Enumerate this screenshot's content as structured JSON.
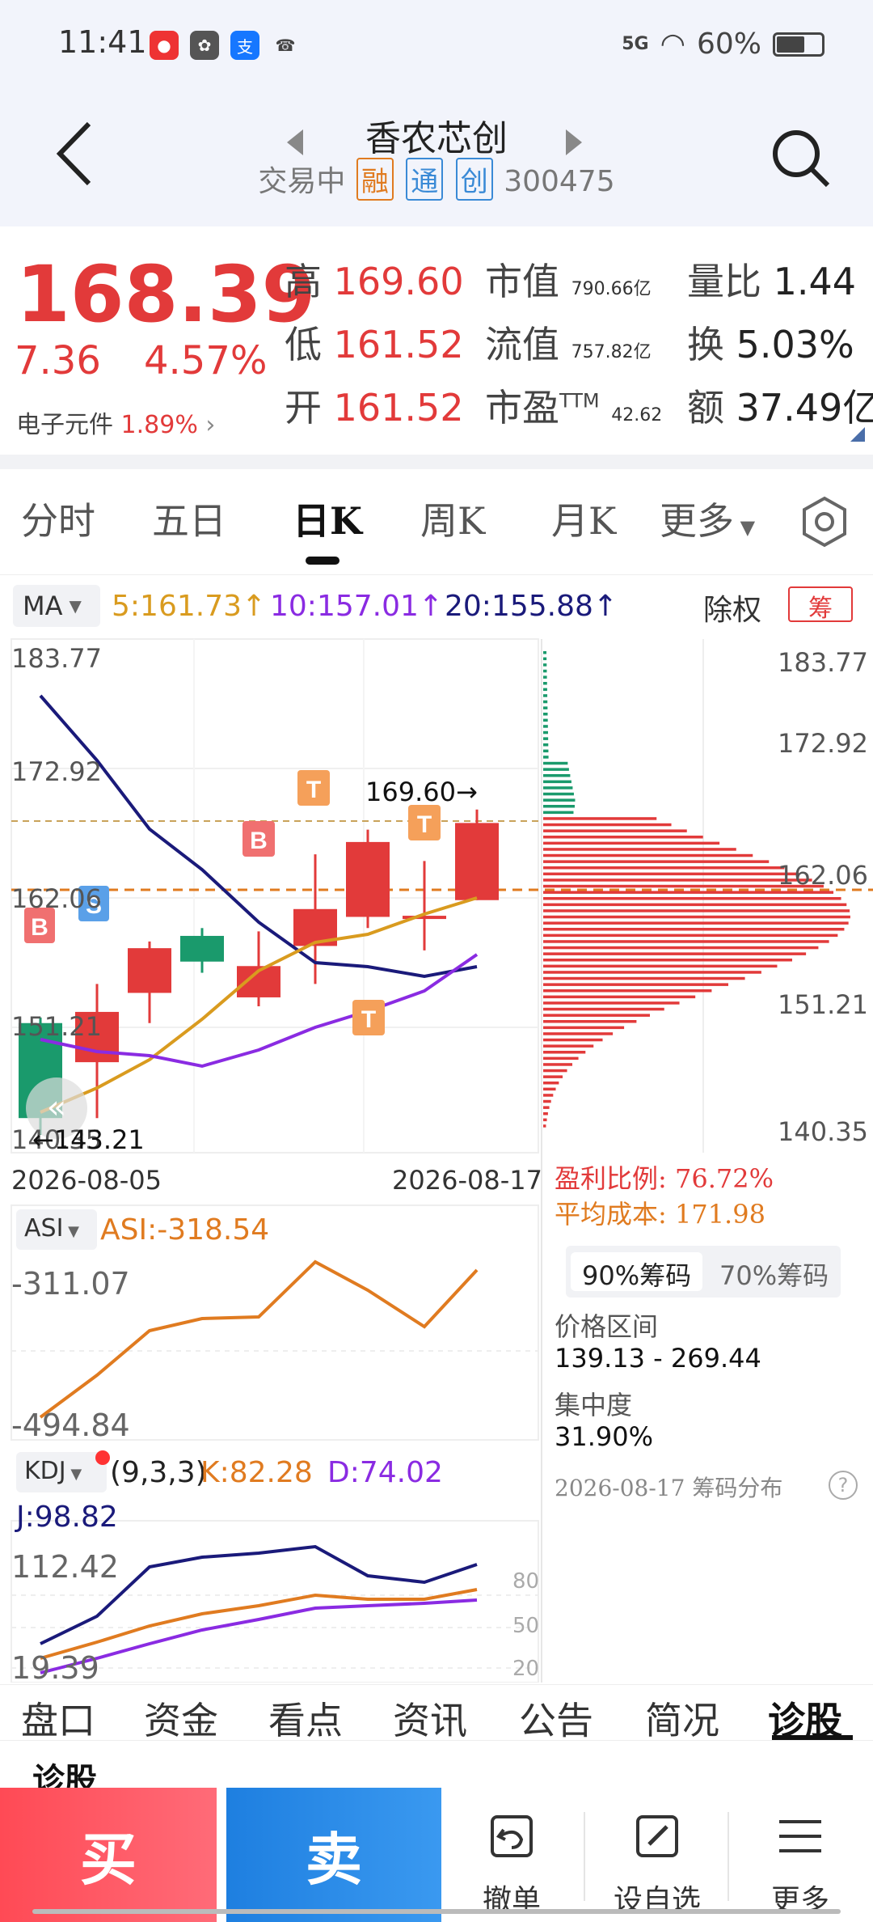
{
  "status_bar": {
    "time": "11:41",
    "signal": "5G",
    "battery": "60%"
  },
  "header": {
    "title": "香农芯创",
    "status": "交易中",
    "tags": [
      "融",
      "通",
      "创"
    ],
    "code": "300475"
  },
  "quote": {
    "price": "168.39",
    "change": "7.36",
    "change_pct": "4.57%",
    "sector_name": "电子元件",
    "sector_pct": "1.89%",
    "high_label": "高",
    "high": "169.60",
    "low_label": "低",
    "low": "161.52",
    "open_label": "开",
    "open": "161.52",
    "mktcap_label": "市值",
    "mktcap": "790.66亿",
    "float_label": "流值",
    "float": "757.82亿",
    "pe_label": "市盈",
    "pe_sup": "TTM",
    "pe": "42.62",
    "volratio_label": "量比",
    "volratio": "1.44",
    "turnover_label": "换",
    "turnover": "5.03%",
    "amount_label": "额",
    "amount": "37.49亿"
  },
  "period_tabs": [
    "分时",
    "五日",
    "日K",
    "周K",
    "月K",
    "更多"
  ],
  "active_period": "日K",
  "ma": {
    "selector": "MA",
    "ma5": "5:161.73",
    "ma10": "10:157.01",
    "ma20": "20:155.88",
    "arrow": "↑",
    "adjust_label": "除权",
    "chip_label": "筹"
  },
  "kline": {
    "y_labels_left": [
      "183.77",
      "172.92",
      "162.06",
      "151.21",
      "140.35"
    ],
    "y_labels_right": [
      "183.77",
      "172.92",
      "162.06",
      "151.21",
      "140.35"
    ],
    "max_label": "169.60→",
    "min_label": "←143.21",
    "date_start": "2026-08-05",
    "date_end": "2026-08-17",
    "markers": [
      "B",
      "S",
      "B",
      "T",
      "T",
      "T"
    ]
  },
  "chip_info": {
    "profit_label": "盈利比例:",
    "profit": "76.72%",
    "cost_label": "平均成本:",
    "cost": "171.98",
    "tab_90": "90%筹码",
    "tab_70": "70%筹码",
    "range_label": "价格区间",
    "range": "139.13 - 269.44",
    "concentration_label": "集中度",
    "concentration": "31.90%",
    "footer": "2026-08-17 筹码分布"
  },
  "asi": {
    "selector": "ASI",
    "value": "ASI:-318.54",
    "y_top": "-311.07",
    "y_bottom": "-494.84"
  },
  "kdj": {
    "selector": "KDJ",
    "params": "(9,3,3)",
    "k": "K:82.28",
    "d": "D:74.02",
    "j": "J:98.82",
    "y_top": "112.42",
    "y_bottom": "19.39",
    "levels": [
      "80",
      "50",
      "20"
    ]
  },
  "bottom_tabs": [
    "盘口",
    "资金",
    "看点",
    "资讯",
    "公告",
    "简况",
    "诊股"
  ],
  "active_bottom_tab": "诊股",
  "partial_text": "诊股",
  "actions": {
    "buy": "买",
    "sell": "卖",
    "cancel": "撤单",
    "watchlist": "设自选",
    "more": "更多"
  },
  "colors": {
    "up": "#e23a3a",
    "down": "#1a9a6c",
    "ma5": "#d99b1f",
    "ma10": "#8a2be2",
    "ma20": "#1a1a7a"
  }
}
